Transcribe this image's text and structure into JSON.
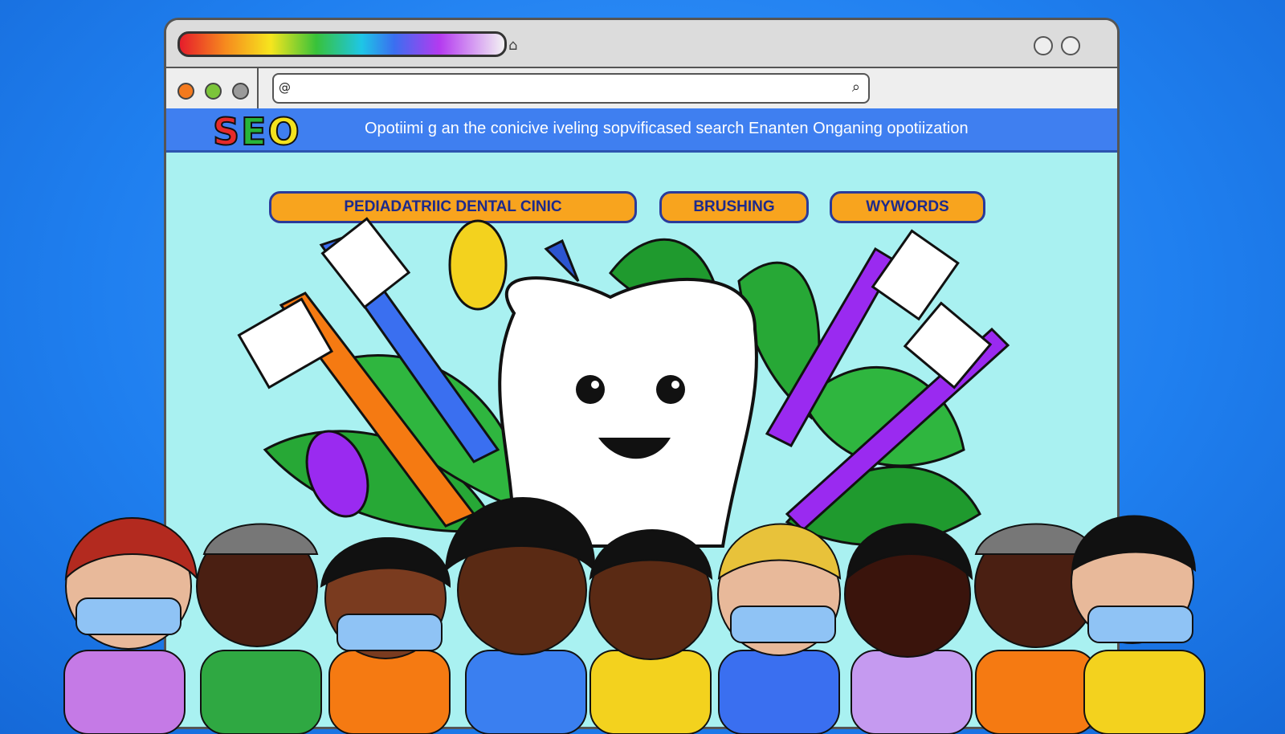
{
  "browser": {
    "url": "",
    "tab_title": ""
  },
  "header": {
    "logo_letters": [
      "S",
      "E",
      "O"
    ],
    "tagline": "Opotiimi g  an  the  conicive  iveling  sopvificased  search  Enanten  Onganing  opotiization"
  },
  "keyword_pills": [
    {
      "label": "PEDIADATRIIC DENTAL CINIC"
    },
    {
      "label": "BRUSHING"
    },
    {
      "label": "WYWORDS"
    }
  ],
  "icons": [
    "search-icon",
    "window-control-icon",
    "tooth-mascot-icon",
    "toothbrush-icon"
  ],
  "colors": {
    "background": "#1f7fef",
    "header": "#3f7ff0",
    "content": "#a9f1f1",
    "pill": "#f8a41e",
    "pill_text": "#1d2a8c"
  }
}
